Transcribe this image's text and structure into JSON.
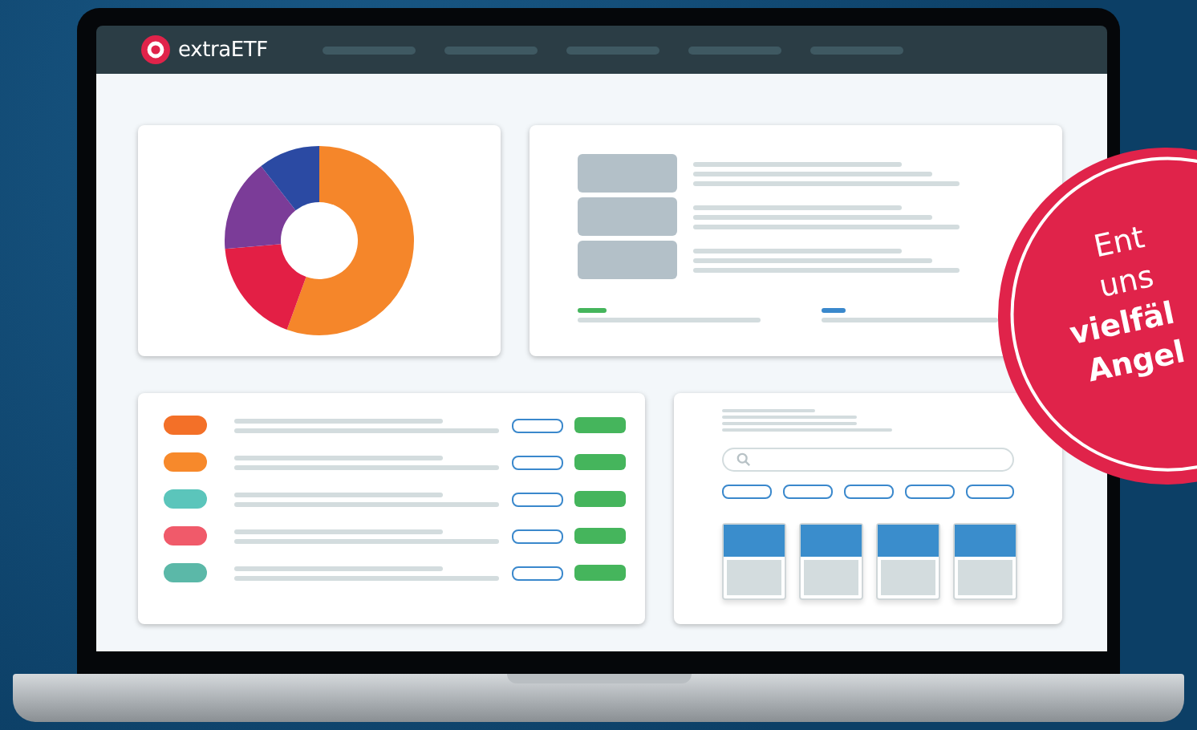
{
  "brand": "extraETF",
  "list_rows": [
    {
      "color": "#f37028"
    },
    {
      "color": "#f7892b"
    },
    {
      "color": "#5bc5bb"
    },
    {
      "color": "#f05a6a"
    },
    {
      "color": "#5bb8a8"
    }
  ],
  "badge": {
    "lines": [
      {
        "text": "Ent",
        "bold": false
      },
      {
        "text": "uns",
        "bold": false
      },
      {
        "text": "vielfäl",
        "bold": true
      },
      {
        "text": "Angel",
        "bold": true
      }
    ]
  }
}
